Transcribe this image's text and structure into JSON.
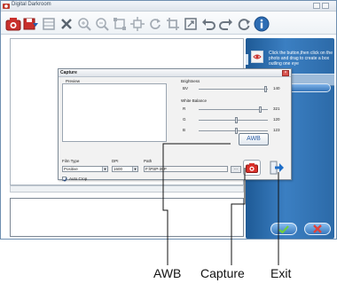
{
  "window": {
    "title": "Digital Darkroom"
  },
  "toolbar": {
    "icons": [
      "camera-scan-icon",
      "save-icon",
      "film-icon",
      "close-icon",
      "zoom-in-icon",
      "zoom-out-icon",
      "select-icon",
      "move-icon",
      "rotate-icon",
      "crop-icon",
      "fit-icon",
      "undo-icon",
      "redo-icon",
      "refresh-icon",
      "info-icon"
    ]
  },
  "right_panel": {
    "help_text": "Click the button,then click on the photo and drag to create a box outling one eye"
  },
  "capture_dialog": {
    "title": "Capture",
    "preview_label": "Preview",
    "brightness": {
      "label": "Brightness",
      "name": "BV",
      "value": "140",
      "level": 0.97
    },
    "white_balance": {
      "label": "White Balance",
      "channels": [
        {
          "name": "R",
          "value": "321",
          "level": 0.9
        },
        {
          "name": "G",
          "value": "120",
          "level": 0.55
        },
        {
          "name": "B",
          "value": "123",
          "level": 0.55
        }
      ]
    },
    "film_type": {
      "label": "Film Type",
      "value": "Positive"
    },
    "dpi": {
      "label": "DPI",
      "value": "1600"
    },
    "path": {
      "label": "Path",
      "value": "F:\\PSP-35P"
    },
    "browse_label": "...",
    "auto_crop": {
      "label": "Auto Crop",
      "checked": true
    },
    "awb_label": "AWB"
  },
  "callouts": {
    "awb": "AWB",
    "capture": "Capture",
    "exit": "Exit"
  },
  "colors": {
    "accent_blue": "#2c6aa8",
    "capture_red": "#d9302a"
  }
}
